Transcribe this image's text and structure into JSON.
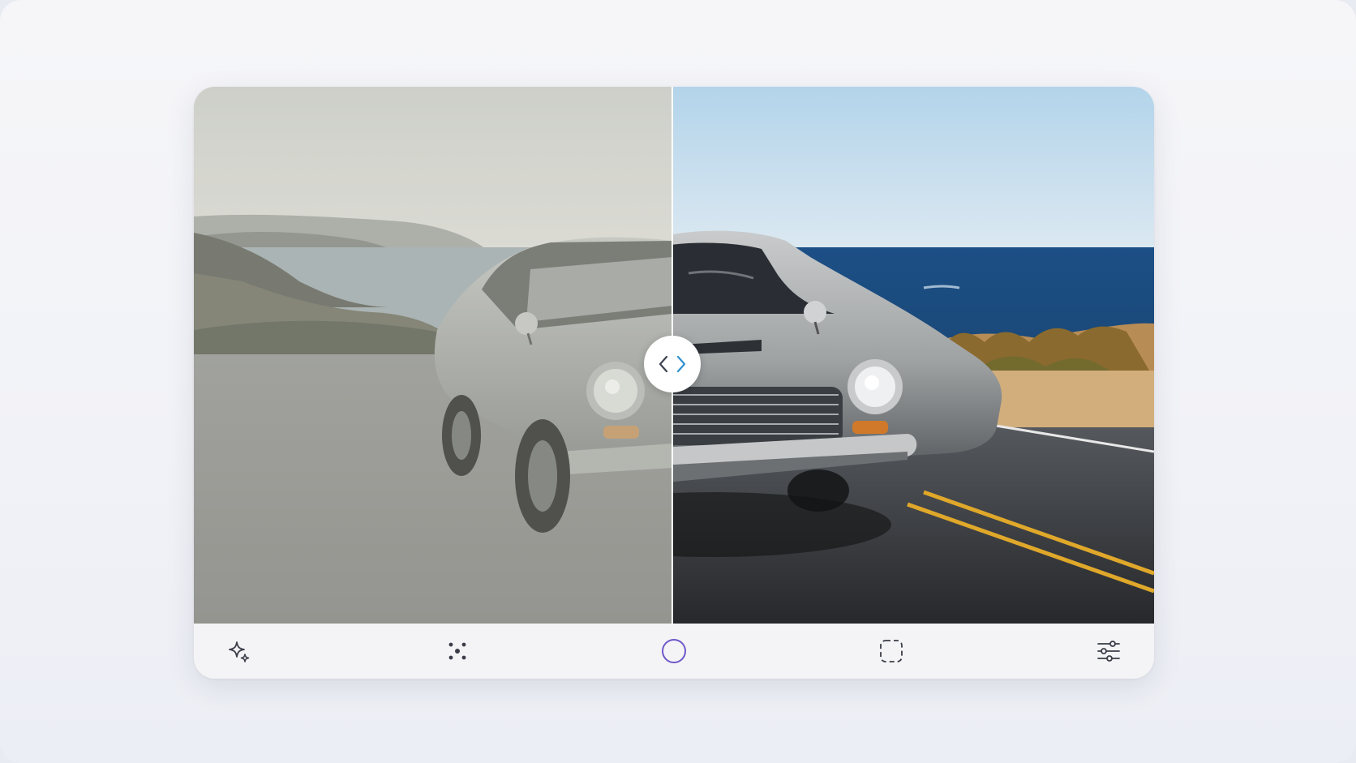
{
  "comparison": {
    "before_image": "vintage-car-original-photo",
    "after_image": "vintage-car-restored-photo",
    "split_position": 0.5
  },
  "handle": {
    "left_icon": "chevron-left-icon",
    "right_icon": "chevron-right-icon",
    "left_color": "#3d4250",
    "right_color": "#2f8fd0"
  },
  "toolbar": {
    "tools": [
      {
        "name": "enhance-sparkle-tool",
        "icon": "sparkles-icon",
        "active": false
      },
      {
        "name": "dots-pattern-tool",
        "icon": "dots-grid-icon",
        "active": false
      },
      {
        "name": "circle-tool",
        "icon": "circle-outline-icon",
        "active": true
      },
      {
        "name": "select-area-tool",
        "icon": "dashed-square-icon",
        "active": false
      },
      {
        "name": "adjust-settings-tool",
        "icon": "sliders-icon",
        "active": false
      }
    ],
    "accent_color": "#6f58c9",
    "icon_color": "#3a3d47"
  }
}
